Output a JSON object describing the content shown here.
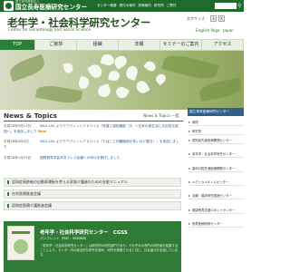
{
  "topbar": {
    "org_small": "国立研究開発法人",
    "org_name": "国立長寿医療研究センター",
    "links": [
      "センター概要",
      "受付の案内",
      "診療案内",
      "研究所",
      "ご寄付"
    ]
  },
  "header": {
    "title": "老年学・社会科学研究センター",
    "subtitle": "Center for Gerontology and Social Science",
    "font_size_label": "文字サイズ",
    "font_btn_small": "小",
    "font_btn_large": "大",
    "lang_en": "English Page",
    "lang_jp": "Japan"
  },
  "nav": {
    "items": [
      "TOP",
      "ご挨拶",
      "組織",
      "年報",
      "セミナーのご案内",
      "アクセス"
    ]
  },
  "news": {
    "title": "News & Topics",
    "more": "News & Topics 一覧",
    "items": [
      {
        "date": "平成28年9月13日",
        "text": "NILS-LSA よりウワヅイントアドバイス「体重と認知機能（3）〜日本の食生活と文化的な認知〜」を追加しました",
        "badge": "New"
      },
      {
        "date": "平成28年4月4日",
        "text": "NILS-LSA よりウワヅイントアドバイス「たばこと内臓脂肪が多いほど要注！」を追加しました",
        "badge": ""
      },
      {
        "date": "平成28年1月25日",
        "text": "国際長寿学会年次プレス会議への申込を受付しました",
        "badge": ""
      }
    ]
  },
  "links": [
    "認知症高齢者の自動車運転を考える家族介護者のための支援マニュアル",
    "在宅医療推進会議",
    "認知症医療介護推進会議"
  ],
  "cgss": {
    "title": "老年学・社会科学研究センター　CGSS",
    "pdf": "パンフレット（PDF：3080KB）",
    "description": "「老年学・社会科学研究センター」は研究所の研究部門であり、それぞれの専門の研究者を結集することにより、センター内の総合的な研究を進め、研究を発展させると共に、社会還元を目指しています。"
  },
  "sidebar": {
    "head": "国立長寿医療研究センター",
    "items": [
      "病院",
      "研究所",
      "認知症先進医療開発センター",
      "老年学・社会科学研究センター",
      "歯科口腔先進医療開発センター",
      "メディカルゲノムセンター",
      "治験・臨床研究推進センター",
      "健康長寿支援ロボットセンター",
      "長寿医療研修センター"
    ]
  }
}
